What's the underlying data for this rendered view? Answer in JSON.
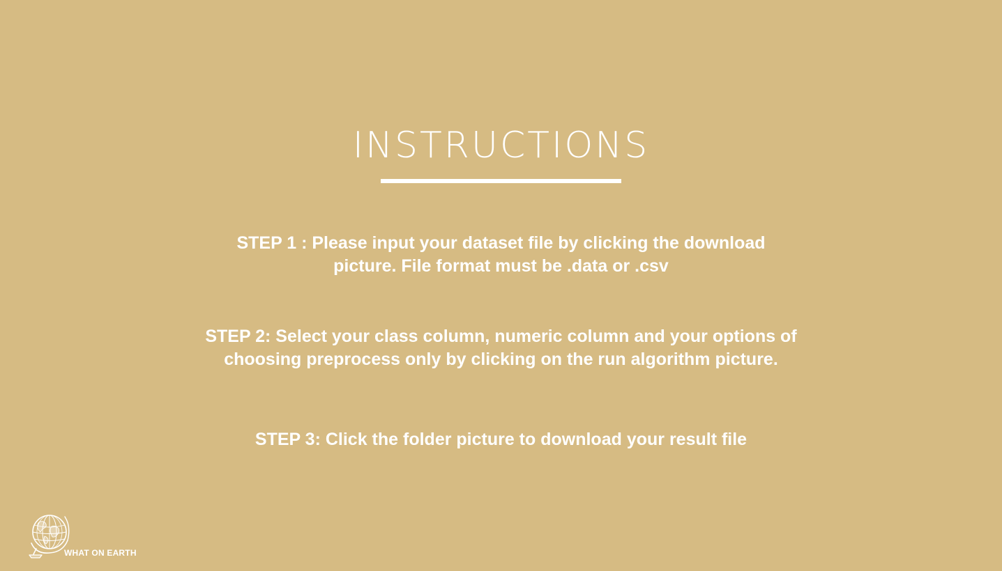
{
  "slide": {
    "title": "INSTRUCTIONS",
    "steps": [
      {
        "lines": [
          "STEP 1 : Please input your dataset file by clicking the download",
          "picture. File format must be .data or .csv"
        ]
      },
      {
        "lines": [
          "STEP 2: Select your class column, numeric column and your options of",
          "choosing preprocess only by clicking on the run algorithm picture."
        ]
      },
      {
        "lines": [
          "STEP 3: Click the folder picture to download your result file"
        ]
      }
    ],
    "logo": {
      "icon": "globe-icon",
      "text": "WHAT ON EARTH"
    }
  },
  "colors": {
    "background": "#d6bb83",
    "foreground": "#ffffff"
  }
}
